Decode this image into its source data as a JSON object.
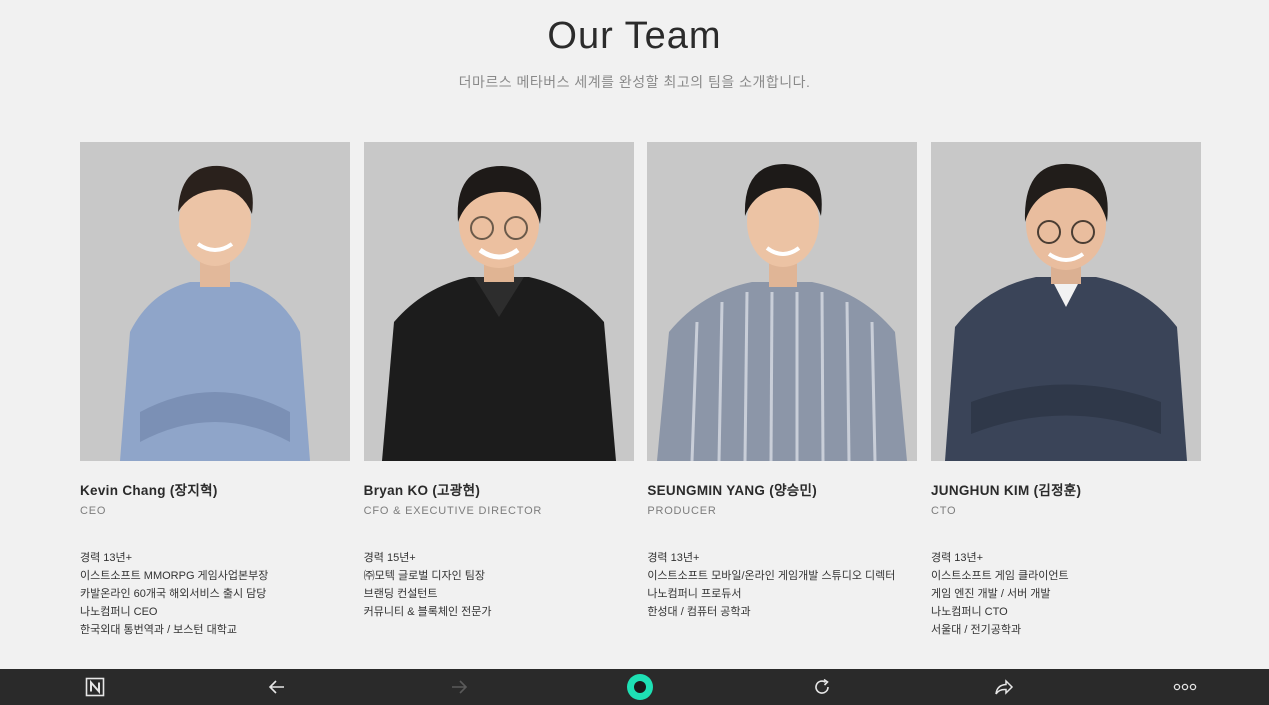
{
  "header": {
    "title": "Our Team",
    "subtitle": "더마르스 메타버스 세계를 완성할 최고의 팀을 소개합니다."
  },
  "members": [
    {
      "name": "Kevin Chang (장지혁)",
      "role": "CEO",
      "shirt_color": "#8fa5c9",
      "bio": [
        "경력 13년+",
        "이스트소프트 MMORPG 게임사업본부장",
        "카발온라인 60개국 해외서비스 출시 담당",
        "나노컴퍼니 CEO",
        "한국외대 통번역과 / 보스턴 대학교"
      ]
    },
    {
      "name": "Bryan KO (고광현)",
      "role": "CFO & EXECUTIVE DIRECTOR",
      "shirt_color": "#1c1c1c",
      "bio": [
        "경력 15년+",
        "㈜모텍 글로벌 디자인 팀장",
        "브랜딩 컨설턴트",
        "커뮤니티 & 블록체인 전문가"
      ]
    },
    {
      "name": "SEUNGMIN YANG (양승민)",
      "role": "PRODUCER",
      "shirt_color": "#8c96a8",
      "bio": [
        "경력 13년+",
        "이스트소프트 모바일/온라인 게임개발 스튜디오 디렉터",
        "나노컴퍼니 프로듀서",
        "한성대 / 컴퓨터 공학과"
      ]
    },
    {
      "name": "JUNGHUN KIM (김정훈)",
      "role": "CTO",
      "shirt_color": "#3a4458",
      "bio": [
        "경력 13년+",
        "이스트소프트 게임 클라이언트",
        "게임 엔진 개발 / 서버 개발",
        "나노컴퍼니 CTO",
        "서울대 / 전기공학과"
      ]
    }
  ],
  "toolbar": {
    "background": "#2a2a2a",
    "accent": "#1ee0b4",
    "icons": [
      "n-logo-icon",
      "back-arrow-icon",
      "forward-arrow-icon",
      "home-circle-icon",
      "refresh-icon",
      "share-icon",
      "more-icon"
    ]
  }
}
